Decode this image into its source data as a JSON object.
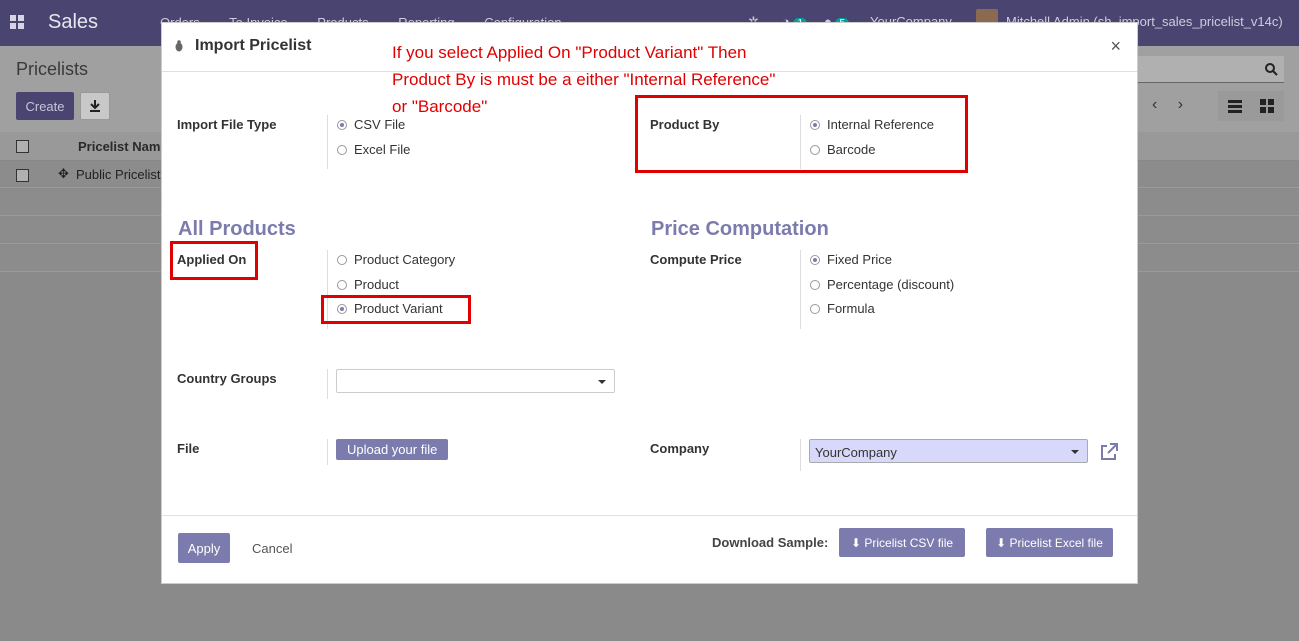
{
  "navbar": {
    "app_title": "Sales",
    "menu": [
      "Orders",
      "To Invoice",
      "Products",
      "Reporting",
      "Configuration"
    ],
    "activity_count": "1",
    "message_count": "5",
    "company": "YourCompany",
    "user": "Mitchell Admin (sh_import_sales_pricelist_v14c)"
  },
  "control_panel": {
    "breadcrumb": "Pricelists",
    "create_label": "Create",
    "pager_prev": "‹",
    "pager_next": "›"
  },
  "list": {
    "header_name": "Pricelist Name",
    "rows": [
      "Public Pricelist"
    ]
  },
  "modal": {
    "title": "Import Pricelist",
    "close": "×",
    "annotation_lines": [
      "If you select Applied On \"Product Variant\" Then",
      "Product By is must be a either \"Internal Reference\"",
      "or \"Barcode\""
    ],
    "import_file_type": {
      "label": "Import File Type",
      "options": [
        "CSV File",
        "Excel File"
      ],
      "selected": "CSV File"
    },
    "product_by": {
      "label": "Product By",
      "options": [
        "Internal Reference",
        "Barcode"
      ],
      "selected": "Internal Reference"
    },
    "all_products_title": "All Products",
    "price_computation_title": "Price Computation",
    "applied_on": {
      "label": "Applied On",
      "options": [
        "Product Category",
        "Product",
        "Product Variant"
      ],
      "selected": "Product Variant"
    },
    "compute_price": {
      "label": "Compute Price",
      "options": [
        "Fixed Price",
        "Percentage (discount)",
        "Formula"
      ],
      "selected": "Fixed Price"
    },
    "country_groups": {
      "label": "Country Groups",
      "value": ""
    },
    "file": {
      "label": "File",
      "button": "Upload your file"
    },
    "company": {
      "label": "Company",
      "value": "YourCompany"
    },
    "footer": {
      "apply": "Apply",
      "cancel": "Cancel",
      "download_label": "Download Sample:",
      "csv_button": "Pricelist CSV file",
      "excel_button": "Pricelist Excel file"
    }
  },
  "colors": {
    "primary": "#7c7bad",
    "navbar": "#4a4470",
    "annotation": "#e00000"
  }
}
